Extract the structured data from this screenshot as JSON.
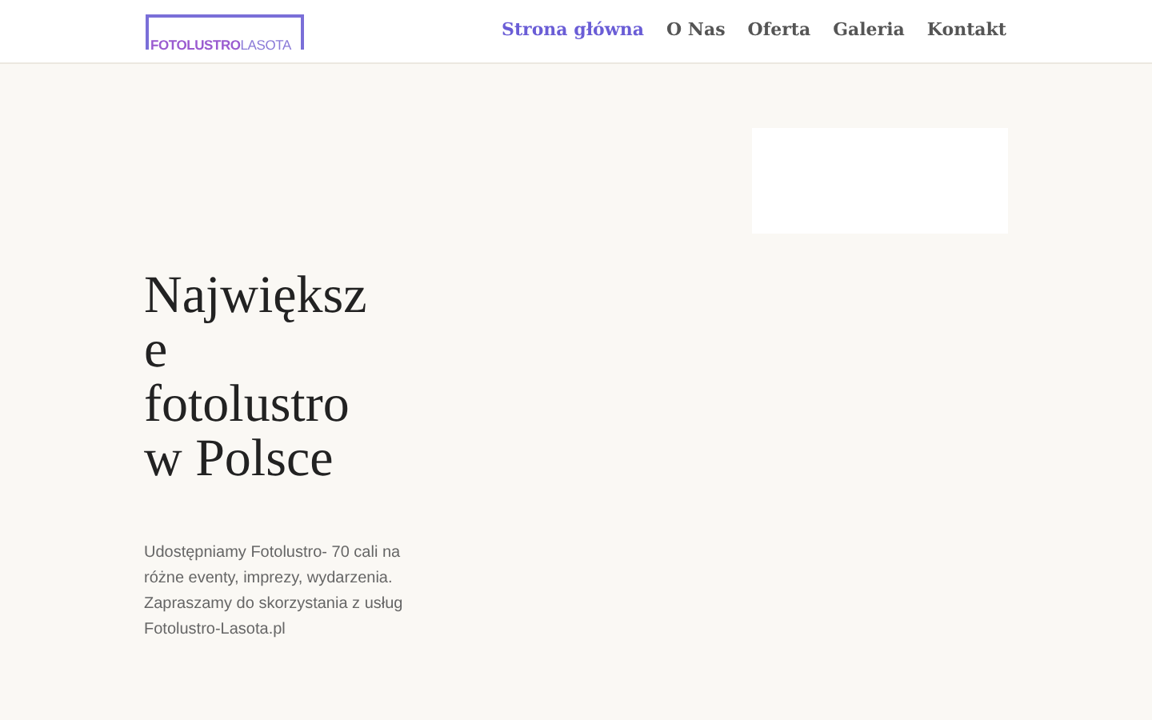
{
  "logo": {
    "part_1": "FOTOLUSTRO",
    "part_2": "LASOTA"
  },
  "nav": [
    {
      "label": "Strona główna",
      "selected": true
    },
    {
      "label": "O Nas",
      "selected": false
    },
    {
      "label": "Oferta",
      "selected": false
    },
    {
      "label": "Galeria",
      "selected": false
    },
    {
      "label": "Kontakt",
      "selected": false
    }
  ],
  "hero": {
    "heading": "Największe fotolustro w Polsce",
    "text": "Udostępniamy Fotolustro- 70 cali na różne eventy, imprezy, wydarzenia. Zapraszamy do skorzystania z usług Fotolustro-Lasota.pl"
  }
}
